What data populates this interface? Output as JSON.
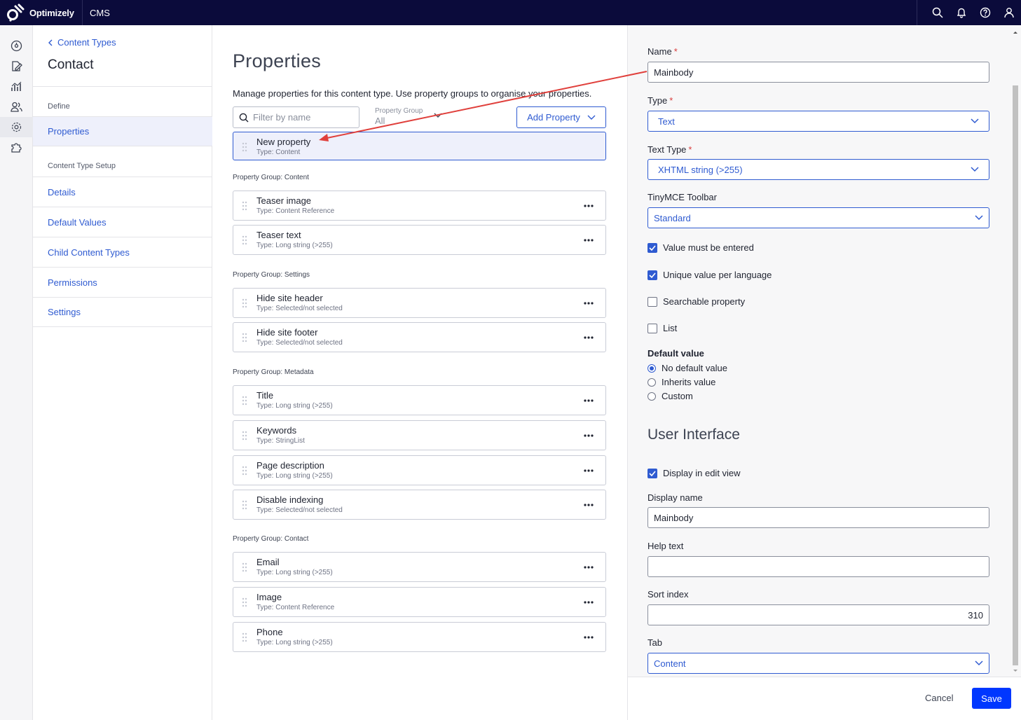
{
  "header": {
    "brand": "Optimizely",
    "app": "CMS",
    "icons": [
      "search-icon",
      "bell-icon",
      "help-icon",
      "user-icon"
    ]
  },
  "rail": {
    "icons": [
      "dashboard-icon",
      "edit-icon",
      "analytics-icon",
      "visitor-groups-icon",
      "settings-icon",
      "addons-icon"
    ]
  },
  "subnav": {
    "back_label": "Content Types",
    "title": "Contact",
    "define_caption": "Define",
    "define_items": [
      {
        "label": "Properties"
      }
    ],
    "setup_caption": "Content Type Setup",
    "setup_items": [
      {
        "label": "Details"
      },
      {
        "label": "Default Values"
      },
      {
        "label": "Child Content Types"
      },
      {
        "label": "Permissions"
      },
      {
        "label": "Settings"
      }
    ]
  },
  "main": {
    "title": "Properties",
    "description": "Manage properties for this content type. Use property groups to organise your properties.",
    "filter_placeholder": "Filter by name",
    "group_filter_label": "Property Group",
    "group_filter_value": "All",
    "add_property_label": "Add Property",
    "new_property": {
      "name": "New property",
      "type": "Type: Content"
    },
    "groups": [
      {
        "label": "Property Group: Content",
        "items": [
          {
            "name": "Teaser image",
            "type": "Type: Content Reference"
          },
          {
            "name": "Teaser text",
            "type": "Type: Long string (>255)"
          }
        ]
      },
      {
        "label": "Property Group: Settings",
        "items": [
          {
            "name": "Hide site header",
            "type": "Type: Selected/not selected"
          },
          {
            "name": "Hide site footer",
            "type": "Type: Selected/not selected"
          }
        ]
      },
      {
        "label": "Property Group: Metadata",
        "items": [
          {
            "name": "Title",
            "type": "Type: Long string (>255)"
          },
          {
            "name": "Keywords",
            "type": "Type: StringList"
          },
          {
            "name": "Page description",
            "type": "Type: Long string (>255)"
          },
          {
            "name": "Disable indexing",
            "type": "Type: Selected/not selected"
          }
        ]
      },
      {
        "label": "Property Group: Contact",
        "items": [
          {
            "name": "Email",
            "type": "Type: Long string (>255)"
          },
          {
            "name": "Image",
            "type": "Type: Content Reference"
          },
          {
            "name": "Phone",
            "type": "Type: Long string (>255)"
          }
        ]
      }
    ]
  },
  "panel": {
    "name_label": "Name",
    "name_value": "Mainbody",
    "type_label": "Type",
    "type_value": "Text",
    "text_type_label": "Text Type",
    "text_type_value": "XHTML string (>255)",
    "toolbar_label": "TinyMCE Toolbar",
    "toolbar_value": "Standard",
    "checkboxes": [
      {
        "label": "Value must be entered",
        "checked": true
      },
      {
        "label": "Unique value per language",
        "checked": true
      },
      {
        "label": "Searchable property",
        "checked": false
      },
      {
        "label": "List",
        "checked": false
      }
    ],
    "default_value_title": "Default value",
    "default_options": [
      {
        "label": "No default value",
        "selected": true
      },
      {
        "label": "Inherits value",
        "selected": false
      },
      {
        "label": "Custom",
        "selected": false
      }
    ],
    "ui_title": "User Interface",
    "display_in_edit_label": "Display in edit view",
    "display_in_edit_checked": true,
    "display_name_label": "Display name",
    "display_name_value": "Mainbody",
    "help_text_label": "Help text",
    "help_text_value": "",
    "sort_index_label": "Sort index",
    "sort_index_value": "310",
    "tab_label": "Tab",
    "tab_value": "Content",
    "cancel_label": "Cancel",
    "save_label": "Save"
  },
  "colors": {
    "topbar": "#0b0b3b",
    "accent": "#2f5bd1",
    "save": "#0037ff",
    "required": "#d93c3c",
    "annotation_arrow": "#e0403c"
  }
}
